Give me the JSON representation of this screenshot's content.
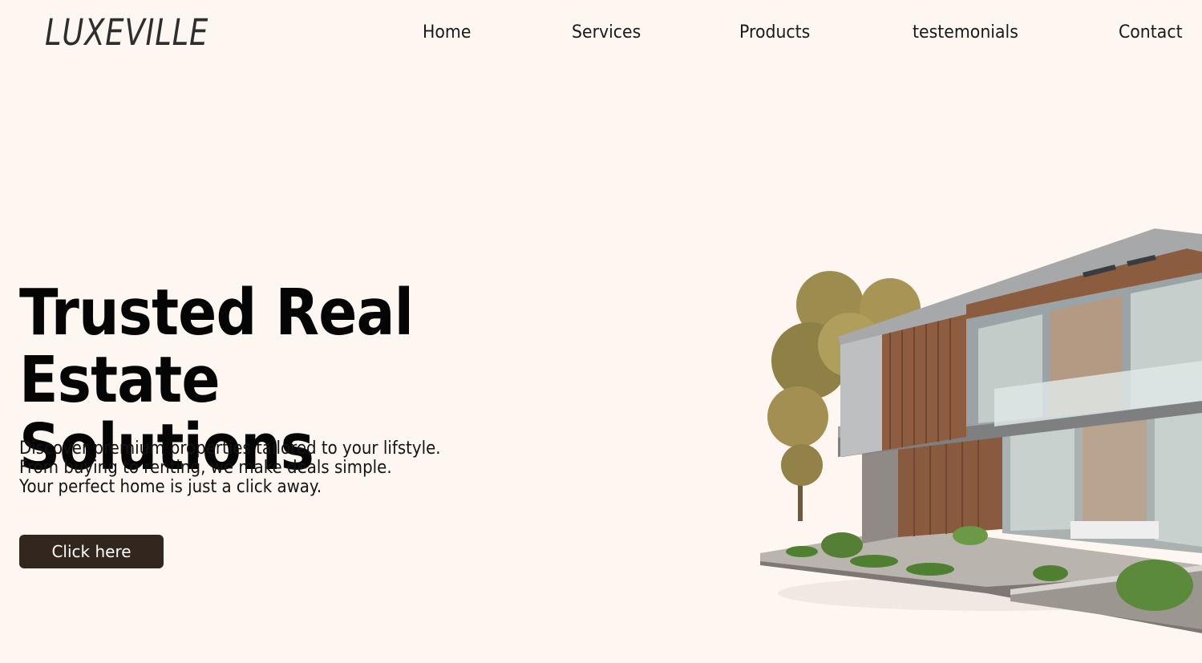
{
  "brand": {
    "logo_text": "LUXEVILLE"
  },
  "nav": {
    "items": [
      {
        "label": "Home"
      },
      {
        "label": "Services"
      },
      {
        "label": "Products"
      },
      {
        "label": "testemonials"
      },
      {
        "label": "Contact"
      }
    ]
  },
  "hero": {
    "title_line1": "Trusted Real",
    "title_line2": "Estate Solutions",
    "subtitle_lines": [
      "Discover premium properties tailored to your lifstyle.",
      "From buying to renting, we make deals simple.",
      "Your perfect home is just a click away."
    ],
    "cta_label": "Click here"
  },
  "colors": {
    "background": "#fdf6f1",
    "cta_background": "#33261f",
    "text": "#111111"
  }
}
